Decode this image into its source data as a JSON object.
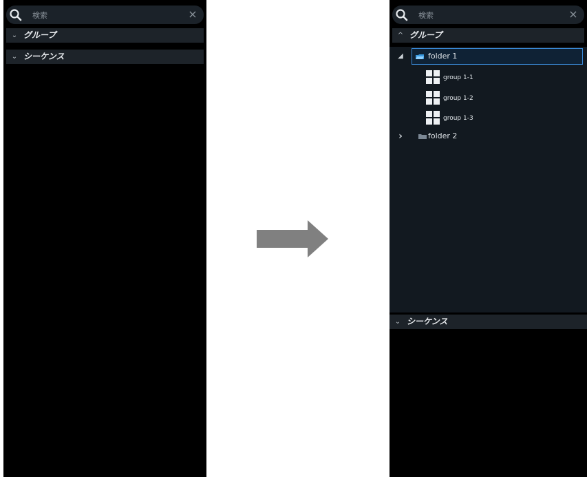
{
  "search": {
    "placeholder": "検索",
    "clear_symbol": "×"
  },
  "sections": {
    "group_label": "グループ",
    "sequence_label": "シーケンス"
  },
  "left_panel": {
    "group_chevron": "⌄",
    "sequence_chevron": "⌄"
  },
  "right_panel": {
    "group_chevron": "^",
    "sequence_chevron": "⌄",
    "tree": {
      "folders": [
        {
          "label": "folder 1",
          "expander": "◢",
          "expanded": true,
          "selected": true,
          "children": [
            {
              "label": "group 1-1"
            },
            {
              "label": "group 1-2"
            },
            {
              "label": "group 1-3"
            }
          ]
        },
        {
          "label": "folder 2",
          "expander": "›",
          "expanded": false,
          "selected": false,
          "children": []
        }
      ]
    }
  },
  "colors": {
    "panel_bg": "#000000",
    "header_bg": "#1d2329",
    "tree_bg": "#121920",
    "selection_border": "#3a8ad8",
    "arrow": "#808080"
  }
}
